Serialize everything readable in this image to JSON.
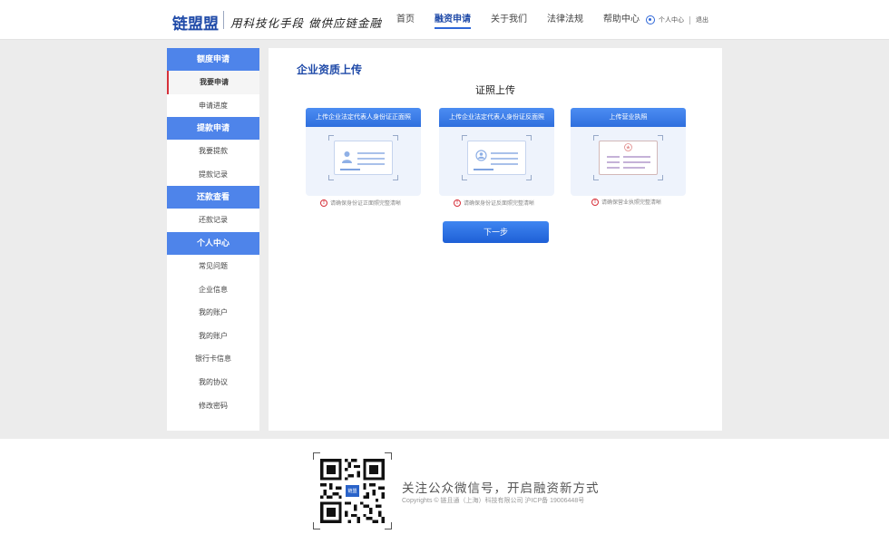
{
  "header": {
    "logo": "链盟盟",
    "slogan": "用科技化手段 做供应链金融",
    "nav": [
      {
        "label": "首页",
        "active": false
      },
      {
        "label": "融资申请",
        "active": true
      },
      {
        "label": "关于我们",
        "active": false
      },
      {
        "label": "法律法规",
        "active": false
      },
      {
        "label": "帮助中心",
        "active": false
      }
    ],
    "user_center": "个人中心",
    "logout": "退出"
  },
  "sidebar": {
    "groups": [
      {
        "title": "额度申请",
        "items": [
          {
            "label": "我要申请",
            "active": true
          },
          {
            "label": "申请进度",
            "active": false
          }
        ]
      },
      {
        "title": "提款申请",
        "items": [
          {
            "label": "我要提款",
            "active": false
          },
          {
            "label": "提款记录",
            "active": false
          }
        ]
      },
      {
        "title": "还款查看",
        "items": [
          {
            "label": "还款记录",
            "active": false
          }
        ]
      },
      {
        "title": "个人中心",
        "items": [
          {
            "label": "常见问题",
            "active": false
          },
          {
            "label": "企业信息",
            "active": false
          },
          {
            "label": "我的账户",
            "active": false
          },
          {
            "label": "我的账户",
            "active": false
          },
          {
            "label": "银行卡信息",
            "active": false
          },
          {
            "label": "我的协议",
            "active": false
          },
          {
            "label": "修改密码",
            "active": false
          }
        ]
      }
    ]
  },
  "main": {
    "title": "企业资质上传",
    "subtitle": "证照上传",
    "cards": [
      {
        "header": "上传企业法定代表人身份证正面照",
        "icon": "id-card-front-icon",
        "hint": "请确保身份证正面照完整清晰"
      },
      {
        "header": "上传企业法定代表人身份证反面照",
        "icon": "id-card-back-icon",
        "hint": "请确保身份证反面照完整清晰"
      },
      {
        "header": "上传营业执照",
        "icon": "business-license-icon",
        "hint": "请确保营业执照完整清晰"
      }
    ],
    "next_button": "下一步"
  },
  "footer": {
    "qr_badge": "链盟",
    "slogan": "关注公众微信号，开启融资新方式",
    "copyright": "Copyrights © 链且通（上海）科技有限公司 沪ICP备 19006448号"
  },
  "colors": {
    "accent": "#4e84ea",
    "primary_dark": "#1f4aa8",
    "warning": "#d6303a"
  }
}
